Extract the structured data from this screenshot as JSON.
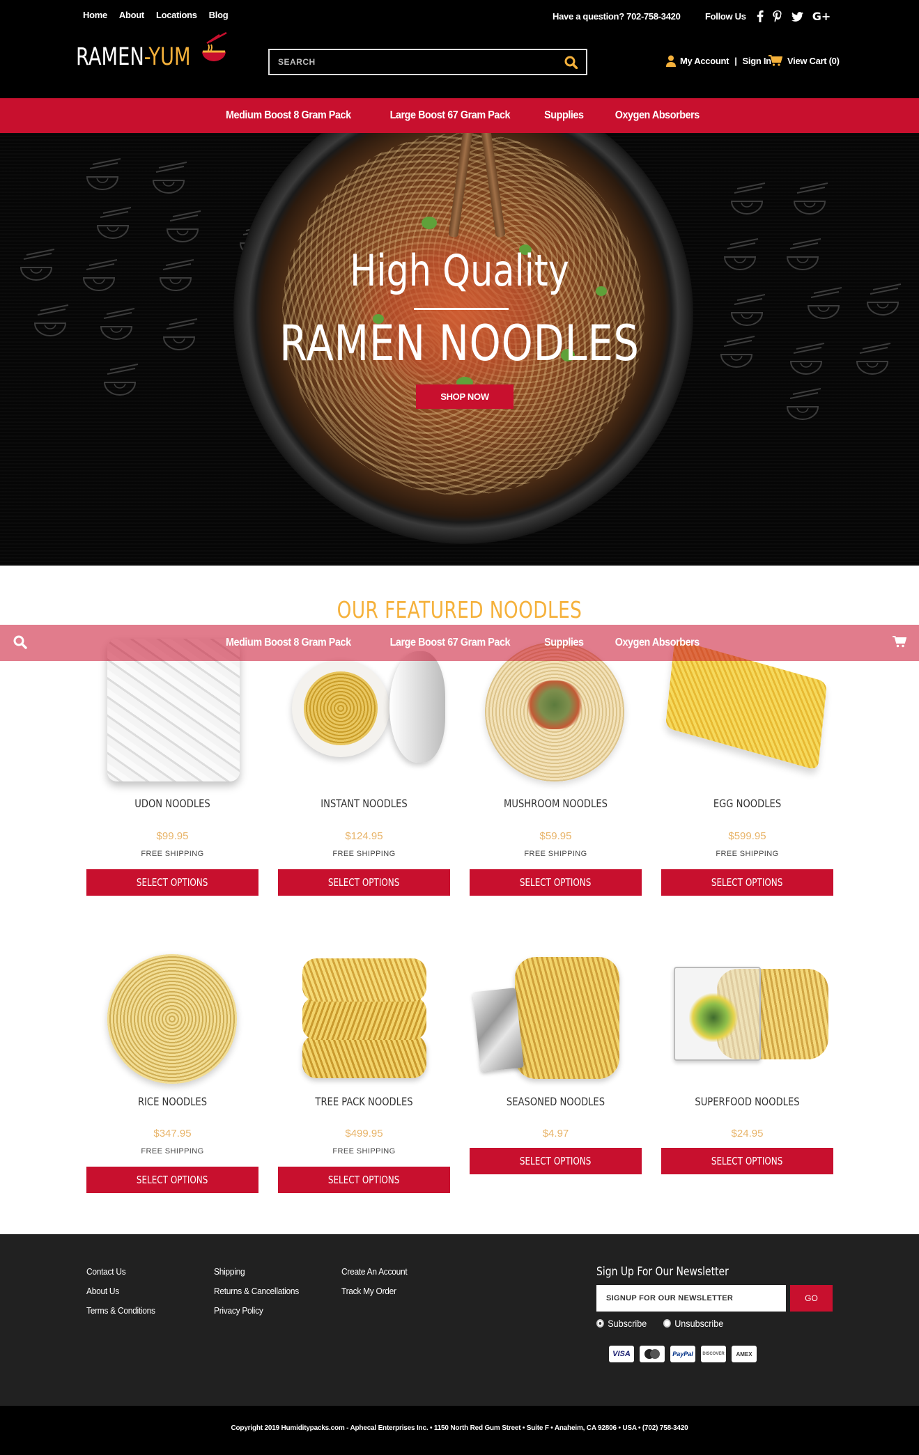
{
  "header": {
    "top_links": [
      "Home",
      "About",
      "Locations",
      "Blog"
    ],
    "question": "Have a question? 702-758-3420",
    "follow_label": "Follow Us",
    "social_icons": [
      "facebook-icon",
      "pinterest-icon",
      "twitter-icon",
      "google-plus-icon"
    ],
    "logo_white": "RAMEN",
    "logo_dash": "-",
    "logo_yellow": "YUM",
    "search_placeholder": "SEARCH",
    "account_label": "My Account",
    "account_sep": "|",
    "signin_label": "Sign In",
    "cart_label": "View Cart (0)"
  },
  "nav": [
    "Medium Boost 8 Gram Pack",
    "Large Boost 67 Gram Pack",
    "Supplies",
    "Oxygen Absorbers"
  ],
  "hero": {
    "title_line1": "High Quality",
    "title_line2": "RAMEN NOODLES",
    "cta": "SHOP NOW"
  },
  "featured": {
    "title": "OUR FEATURED NOODLES",
    "button_label": "SELECT OPTIONS",
    "products": [
      {
        "name": "UDON NOODLES",
        "price": "$99.95",
        "shipping": "FREE SHIPPING"
      },
      {
        "name": "INSTANT NOODLES",
        "price": "$124.95",
        "shipping": "FREE SHIPPING"
      },
      {
        "name": "MUSHROOM NOODLES",
        "price": "$59.95",
        "shipping": "FREE SHIPPING"
      },
      {
        "name": "EGG NOODLES",
        "price": "$599.95",
        "shipping": "FREE SHIPPING"
      },
      {
        "name": "RICE NOODLES",
        "price": "$347.95",
        "shipping": "FREE SHIPPING"
      },
      {
        "name": "TREE PACK NOODLES",
        "price": "$499.95",
        "shipping": "FREE SHIPPING"
      },
      {
        "name": "SEASONED NOODLES",
        "price": "$4.97",
        "shipping": ""
      },
      {
        "name": "SUPERFOOD NOODLES",
        "price": "$24.95",
        "shipping": ""
      }
    ]
  },
  "footer": {
    "col1": [
      "Contact Us",
      "About Us",
      "Terms & Conditions"
    ],
    "col2": [
      "Shipping",
      "Returns & Cancellations",
      "Privacy Policy"
    ],
    "col3": [
      "Create An Account",
      "Track My Order"
    ],
    "newsletter_title": "Sign Up For Our Newsletter",
    "newsletter_placeholder": "SIGNUP FOR OUR NEWSLETTER",
    "go_label": "GO",
    "subscribe": "Subscribe",
    "unsubscribe": "Unsubscribe",
    "cards": [
      "VISA",
      "MC",
      "PayPal",
      "DISCOVER",
      "AMEX"
    ],
    "copyright": "Copyright 2019 Humiditypacks.com - Aphecal Enterprises Inc. • 1150 North Red Gum Street • Suite F • Anaheim, CA 92806 • USA • (702) 758-3420"
  },
  "colors": {
    "brand_red": "#c8102e",
    "accent_gold": "#f5b13b",
    "price_gold": "#e8b469",
    "footer_bg": "#212121"
  }
}
